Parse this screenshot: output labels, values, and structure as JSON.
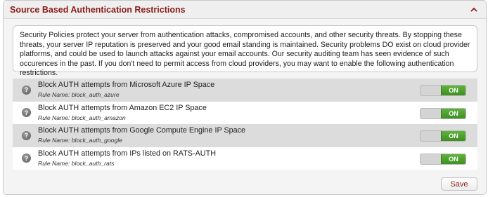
{
  "panel": {
    "title": "Source Based Authentication Restrictions",
    "collapse_icon": "chevron-up-icon"
  },
  "info": {
    "text": "Security Policies protect your server from authentication attacks, compromised accounts, and other security threats. By stopping these threats, your server IP reputation is preserved and your good email standing is maintained. Security problems DO exist on cloud provider platforms, and could be used to launch attacks against your email accounts. Our security auditing team has seen evidence of such occurences in the past. If you don't need to permit access from cloud providers, you may want to enable the following authentication restrictions."
  },
  "rules": [
    {
      "title": "Block AUTH attempts from Microsoft Azure IP Space",
      "rule_name": "Rule Name: block_auth_azure",
      "toggle": "ON"
    },
    {
      "title": "Block AUTH attempts from Amazon EC2 IP Space",
      "rule_name": "Rule Name: block_auth_amazon",
      "toggle": "ON"
    },
    {
      "title": "Block AUTH attempts from Google Compute Engine IP Space",
      "rule_name": "Rule Name: block_auth_google",
      "toggle": "ON"
    },
    {
      "title": "Block AUTH attempts from IPs listed on RATS-AUTH",
      "rule_name": "Rule Name: block_auth_rats",
      "toggle": "ON"
    }
  ],
  "help_glyph": "?",
  "save_label": "Save",
  "colors": {
    "title_red": "#8a1b1b",
    "toggle_green": "#4a9e2c",
    "row_gray": "#dcdcdc"
  }
}
